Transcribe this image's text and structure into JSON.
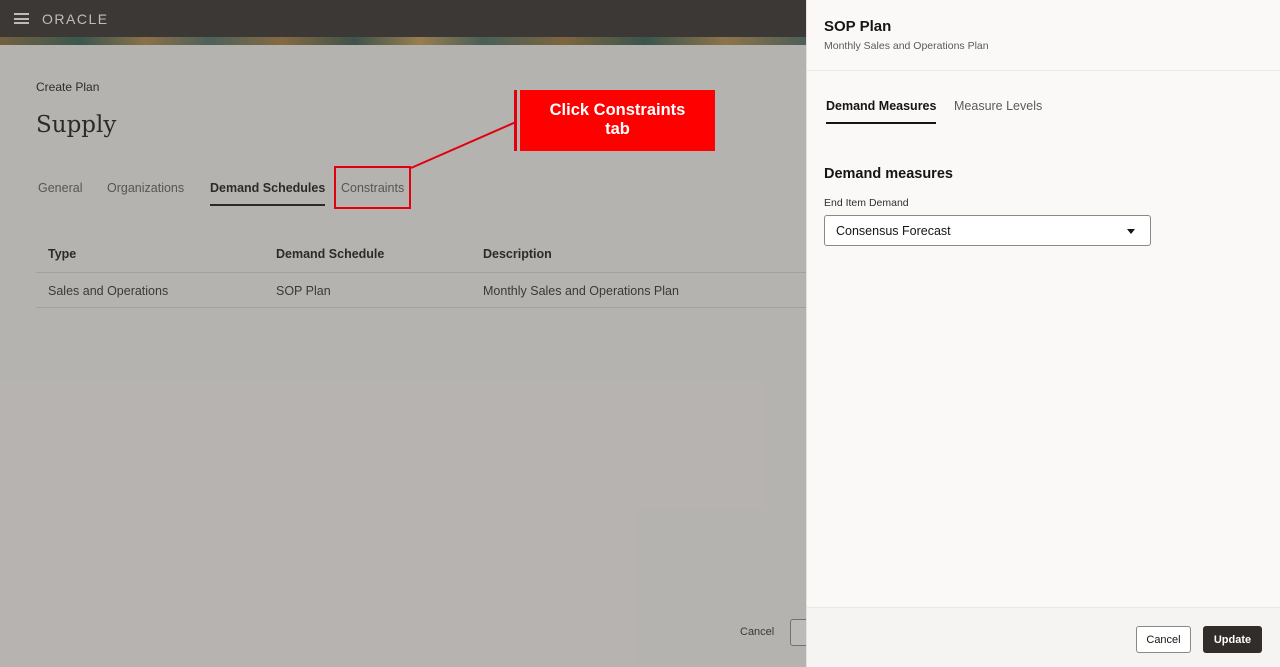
{
  "header": {
    "brand": "ORACLE"
  },
  "page": {
    "breadcrumb": "Create Plan",
    "title": "Supply",
    "tabs": [
      "General",
      "Organizations",
      "Demand Schedules",
      "Constraints"
    ],
    "active_tab": "Demand Schedules",
    "table": {
      "columns": [
        "Type",
        "Demand Schedule",
        "Description"
      ],
      "rows": [
        [
          "Sales and Operations",
          "SOP Plan",
          "Monthly Sales and Operations Plan"
        ]
      ]
    },
    "footer": {
      "cancel_label": "Cancel"
    }
  },
  "callout": {
    "text_line1": "Click Constraints",
    "text_line2": "tab",
    "color": "#ff0000"
  },
  "drawer": {
    "title": "SOP Plan",
    "subtitle": "Monthly Sales and Operations Plan",
    "tabs": [
      "Demand Measures",
      "Measure Levels"
    ],
    "active_tab": "Demand Measures",
    "section_title": "Demand measures",
    "field_label": "End Item Demand",
    "field_value": "Consensus Forecast",
    "cancel_label": "Cancel",
    "update_label": "Update"
  }
}
